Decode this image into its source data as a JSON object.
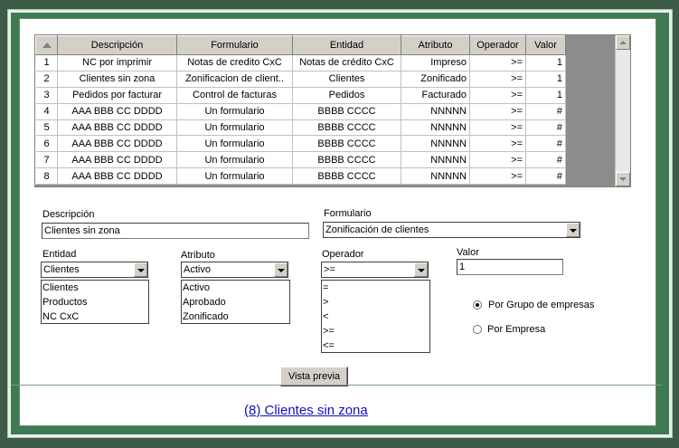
{
  "grid": {
    "columns": [
      "Descripción",
      "Formulario",
      "Entidad",
      "Atributo",
      "Operador",
      "Valor"
    ],
    "rows": [
      {
        "num": "1",
        "descripcion": "NC por imprimir",
        "formulario": "Notas de credito CxC",
        "entidad": "Notas de crédito CxC",
        "atributo": "Impreso",
        "operador": ">=",
        "valor": "1"
      },
      {
        "num": "2",
        "descripcion": "Clientes sin zona",
        "formulario": "Zonificacion de client..",
        "entidad": "Clientes",
        "atributo": "Zonificado",
        "operador": ">=",
        "valor": "1"
      },
      {
        "num": "3",
        "descripcion": "Pedidos por facturar",
        "formulario": "Control de facturas",
        "entidad": "Pedidos",
        "atributo": "Facturado",
        "operador": ">=",
        "valor": "1"
      },
      {
        "num": "4",
        "descripcion": "AAA BBB CC DDDD",
        "formulario": "Un formulario",
        "entidad": "BBBB CCCC",
        "atributo": "NNNNN",
        "operador": ">=",
        "valor": "#"
      },
      {
        "num": "5",
        "descripcion": "AAA BBB CC DDDD",
        "formulario": "Un formulario",
        "entidad": "BBBB CCCC",
        "atributo": "NNNNN",
        "operador": ">=",
        "valor": "#"
      },
      {
        "num": "6",
        "descripcion": "AAA BBB CC DDDD",
        "formulario": "Un formulario",
        "entidad": "BBBB CCCC",
        "atributo": "NNNNN",
        "operador": ">=",
        "valor": "#"
      },
      {
        "num": "7",
        "descripcion": "AAA BBB CC DDDD",
        "formulario": "Un formulario",
        "entidad": "BBBB CCCC",
        "atributo": "NNNNN",
        "operador": ">=",
        "valor": "#"
      },
      {
        "num": "8",
        "descripcion": "AAA BBB CC DDDD",
        "formulario": "Un formulario",
        "entidad": "BBBB CCCC",
        "atributo": "NNNNN",
        "operador": ">=",
        "valor": "#"
      }
    ]
  },
  "form": {
    "descripcion_label": "Descripción",
    "descripcion_value": "Clientes sin zona",
    "formulario_label": "Formulario",
    "formulario_value": "Zonificación de clientes",
    "entidad_label": "Entidad",
    "entidad_value": "Clientes",
    "entidad_options": [
      "Clientes",
      "Productos",
      "NC CxC"
    ],
    "atributo_label": "Atributo",
    "atributo_value": "Activo",
    "atributo_options": [
      "Activo",
      "Aprobado",
      "Zonificado"
    ],
    "operador_label": "Operador",
    "operador_value": ">=",
    "operador_options": [
      "=",
      ">",
      "<",
      ">=",
      "<="
    ],
    "valor_label": "Valor",
    "valor_value": "1",
    "radio_grupo_label": "Por Grupo de empresas",
    "radio_empresa_label": "Por Empresa",
    "preview_button": "Vista previa"
  },
  "result": {
    "link_text": "(8) Clientes sin zona"
  },
  "colors": {
    "background": "#3c5c48",
    "frame": "#3e7a52",
    "link": "#1010c0",
    "header": "#d4d0c8"
  },
  "icons": [
    "sort-arrow-icon",
    "scroll-up-icon",
    "scroll-down-icon",
    "dropdown-arrow-icon",
    "radio-icon"
  ]
}
